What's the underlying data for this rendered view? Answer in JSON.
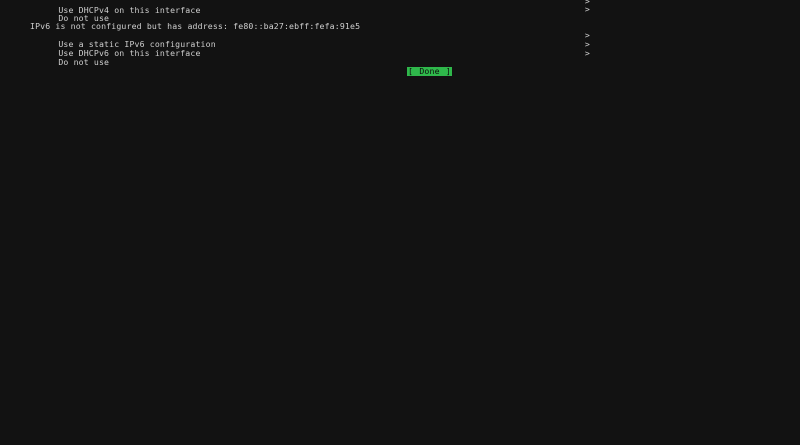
{
  "ipv4": {
    "items": [
      {
        "label": "Use DHCPv4 on this interface",
        "chevron": ">"
      },
      {
        "label": "Do not use",
        "chevron": ">"
      }
    ]
  },
  "ipv6": {
    "header": "IPv6 is not configured but has address: fe80::ba27:ebff:fefa:91e5",
    "items": [
      {
        "label": "Use a static IPv6 configuration",
        "chevron": ">"
      },
      {
        "label": "Use DHCPv6 on this interface",
        "chevron": ">"
      },
      {
        "label": "Do not use",
        "chevron": ">"
      }
    ]
  },
  "done_button": {
    "open": "[",
    "label": "Done",
    "close": "]"
  }
}
